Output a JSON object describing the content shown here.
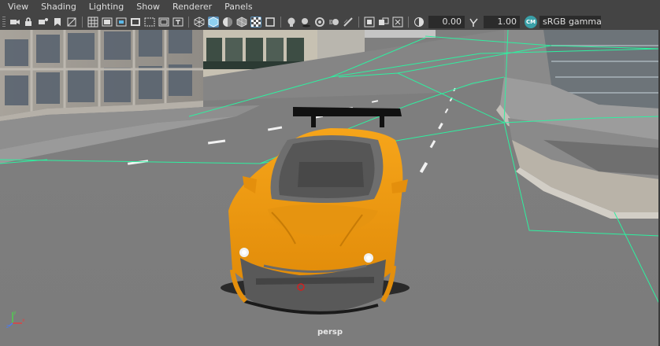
{
  "menu": {
    "items": [
      "View",
      "Shading",
      "Lighting",
      "Show",
      "Renderer",
      "Panels"
    ]
  },
  "toolbar": {
    "camera_icons": [
      "camera-select-icon",
      "lock-camera-icon",
      "camera-attributes-icon",
      "bookmark-icon",
      "image-plane-icon"
    ],
    "grid_icons": [
      "grid-icon",
      "film-gate-icon",
      "resolution-gate-icon",
      "gate-mask-icon",
      "field-chart-icon",
      "safe-action-icon",
      "safe-title-icon"
    ],
    "shading_icons": [
      "wireframe-icon",
      "smooth-shade-icon",
      "default-material-icon",
      "wireframe-on-shaded-icon",
      "xray-icon",
      "textured-icon"
    ],
    "light_icons": [
      "use-all-lights-icon",
      "shadows-icon",
      "ambient-occlusion-icon",
      "motion-blur-icon",
      "anti-aliasing-icon"
    ],
    "isolate_icons": [
      "isolate-select-icon",
      "xray-joints-icon",
      "xray-active-icon"
    ],
    "exposure_value": "0.00",
    "gamma_value": "1.00",
    "color_space_badge": "CM",
    "color_space_label": "sRGB gamma",
    "exposure_icon": "exposure-icon",
    "gamma_icon": "gamma-icon"
  },
  "viewport": {
    "camera_label": "persp",
    "wireframe_color": "#2ef0a0",
    "car_color": "#f29a0f"
  },
  "axis": {
    "x": "x",
    "y": "y",
    "z": "z"
  }
}
